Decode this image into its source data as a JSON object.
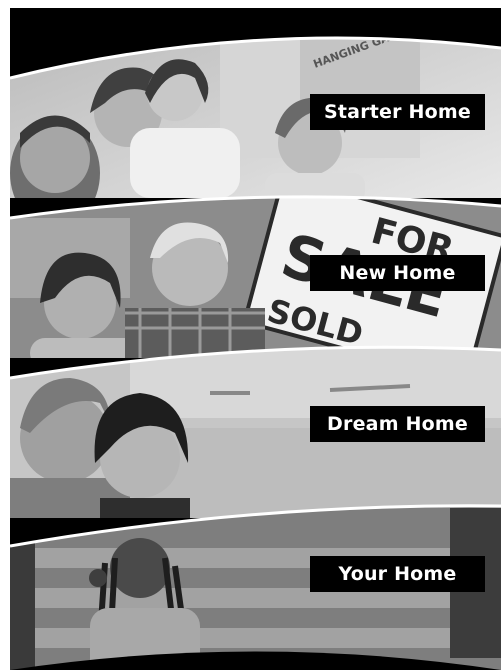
{
  "panels": [
    {
      "label": "Starter Home",
      "scene": "family-with-children"
    },
    {
      "label": "New Home",
      "scene": "couple-with-sold-sign"
    },
    {
      "label": "Dream Home",
      "scene": "young-couple-in-kitchen"
    },
    {
      "label": "Your Home",
      "scene": "man-on-phone-on-steps"
    }
  ],
  "sign": {
    "line1": "FOR",
    "line2": "SALE",
    "line3": "SOLD"
  },
  "box_text": "HANGING GARMENT",
  "colors": {
    "background": "#000000",
    "label_bg": "#000000",
    "label_text": "#ffffff",
    "divider": "#ffffff"
  }
}
